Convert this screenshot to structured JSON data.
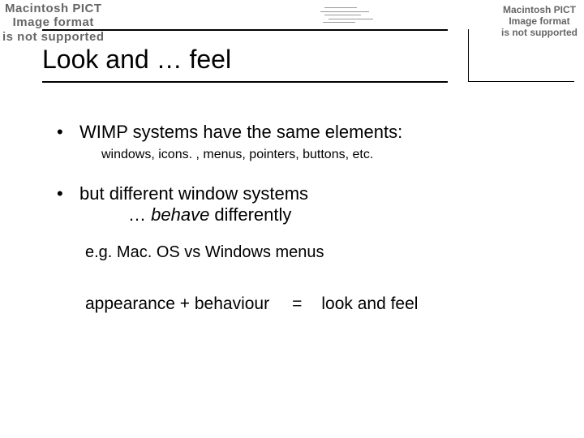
{
  "placeholders": {
    "pict_text": "Macintosh PICT\nImage format\nis not supported"
  },
  "title": "Look and … feel",
  "bullets": {
    "b1": "WIMP systems have the same elements:",
    "b1_sub": "windows, icons. , menus, pointers, buttons, etc.",
    "b2_line1": "but different window systems",
    "b2_line2_prefix": "… ",
    "b2_line2_italic": "behave",
    "b2_line2_rest": " differently",
    "b2_sub": "e.g. Mac. OS vs Windows menus"
  },
  "equation": {
    "left": "appearance + behaviour",
    "mid": "=",
    "right": "look and feel"
  }
}
